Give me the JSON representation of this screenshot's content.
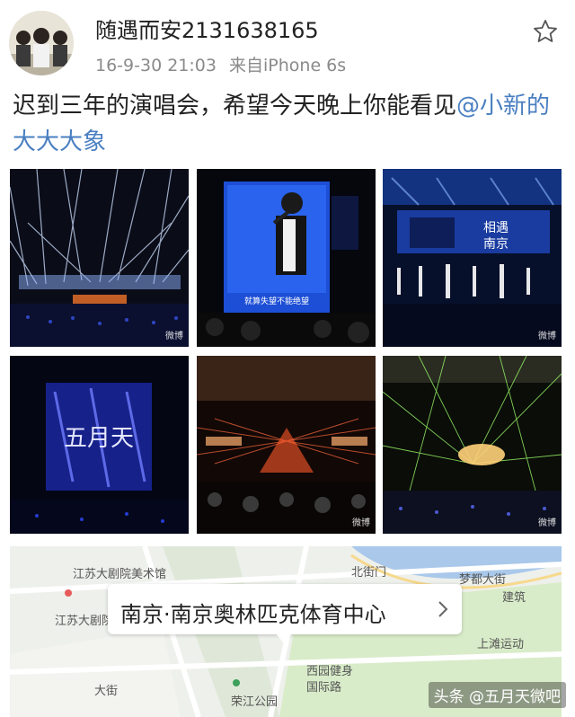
{
  "post": {
    "username": "随遇而安2131638165",
    "timestamp": "16-9-30 21:03",
    "source": "来自iPhone 6s",
    "text": "迟到三年的演唱会，希望今天晚上你能看见",
    "mention": "@小新的大大大象"
  },
  "photos": {
    "p2_subtitle": "就算失望不能绝望",
    "p3_banner_line1": "相遇",
    "p3_banner_line2": "南京",
    "p4_screen_text": "五月天",
    "watermark": "微博"
  },
  "map": {
    "location_label": "南京·南京奥林匹克体育中心",
    "labels": [
      "江苏大剧院美术馆",
      "北街门",
      "梦都大街",
      "建筑",
      "江苏大剧院",
      "上滩运动",
      "西园健身",
      "国际路",
      "荣江公园",
      "大街"
    ]
  },
  "footer": {
    "source_tag": "头条 @五月天微吧"
  },
  "colors": {
    "mention": "#4a7fc1",
    "meta_gray": "#8a8a8a",
    "stage_blue": "#1d4fd6"
  },
  "icons": [
    "star-icon",
    "chevron-right-icon",
    "map-pin-icon"
  ]
}
